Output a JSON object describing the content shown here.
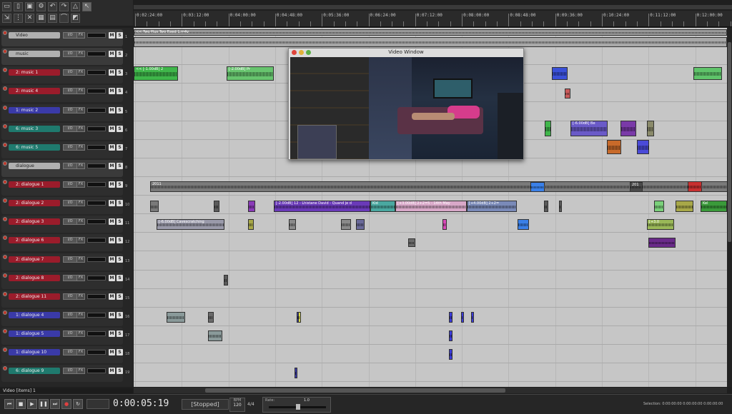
{
  "ruler": {
    "labels": [
      "0:02:24:00",
      "0:03:12:00",
      "0:04:00:00",
      "0:04:48:00",
      "0:05:36:00",
      "0:06:24:00",
      "0:07:12:00",
      "0:08:00:00",
      "0:08:48:00",
      "0:09:36:00",
      "0:10:24:00",
      "0:11:12:00",
      "0:12:00:00"
    ]
  },
  "tracks": [
    {
      "num": "1",
      "name": "Video",
      "color": "#b0b0b0",
      "type": "folder-top"
    },
    {
      "num": "2",
      "name": "music",
      "color": "#b0b0b0",
      "type": "folder"
    },
    {
      "num": "3",
      "name": "2: music 1",
      "color": "#9b1c2b"
    },
    {
      "num": "4",
      "name": "2: music 4",
      "color": "#9b1c2b"
    },
    {
      "num": "5",
      "name": "1: music 2",
      "color": "#3a3aa8"
    },
    {
      "num": "6",
      "name": "6: music 3",
      "color": "#1f7a6e"
    },
    {
      "num": "7",
      "name": "6: music 5",
      "color": "#1f7a6e"
    },
    {
      "num": "8",
      "name": "dialogue",
      "color": "#b0b0b0",
      "type": "folder"
    },
    {
      "num": "9",
      "name": "2: dialogue 1",
      "color": "#9b1c2b"
    },
    {
      "num": "10",
      "name": "2: dialogue 2",
      "color": "#9b1c2b"
    },
    {
      "num": "11",
      "name": "2: dialogue 3",
      "color": "#9b1c2b"
    },
    {
      "num": "12",
      "name": "2: dialogue 6",
      "color": "#9b1c2b"
    },
    {
      "num": "13",
      "name": "2: dialogue 7",
      "color": "#9b1c2b"
    },
    {
      "num": "14",
      "name": "2: dialogue 8",
      "color": "#9b1c2b"
    },
    {
      "num": "15",
      "name": "2: dialogue 11",
      "color": "#9b1c2b"
    },
    {
      "num": "16",
      "name": "1: dialogue 4",
      "color": "#3a3aa8"
    },
    {
      "num": "17",
      "name": "1: dialogue 5",
      "color": "#3a3aa8"
    },
    {
      "num": "18",
      "name": "1: dialogue 10",
      "color": "#3a3aa8"
    },
    {
      "num": "19",
      "name": "6: dialogue 9",
      "color": "#1f7a6e"
    }
  ],
  "track_buttons": {
    "io": "I/O",
    "fx": "FX",
    "m": "M",
    "s": "S",
    "vol": "VOL"
  },
  "items": {
    "video_item": "<< Two Plus Two Fixed 1.m4v",
    "music1_a": "<< [-1.00dB] 2",
    "music1_b": "[-2.00dB] Pr",
    "music3_a": "[-6.00dB] Be",
    "dlg1_a": "2011",
    "dlg1_b": "201",
    "dlg2_a": "[-2.00dB] 12 - Lhistane David - Quand je d",
    "dlg2_b": "Kid",
    "dlg2_c": "[+3.00dB] 2+2=5 - 14th May",
    "dlg2_d": "[+4.00dB] 2+2=",
    "dlg2_e": "Kel",
    "dlg3_a": "[-6.00dB] Cavescratching",
    "dlg3_b": "[+3.0"
  },
  "video_window": {
    "title": "Video Window"
  },
  "status": {
    "text": "Video [items] 1"
  },
  "transport": {
    "time": "0:00:05:19",
    "state": "[Stopped]",
    "bpm_label": "BPM",
    "bpm": "120",
    "timesig": "4/4",
    "rate_label": "Rate:",
    "rate": "1.0",
    "selection": "Selection: 0:00:00:00  0:00:00:00  0:00:00:00"
  }
}
